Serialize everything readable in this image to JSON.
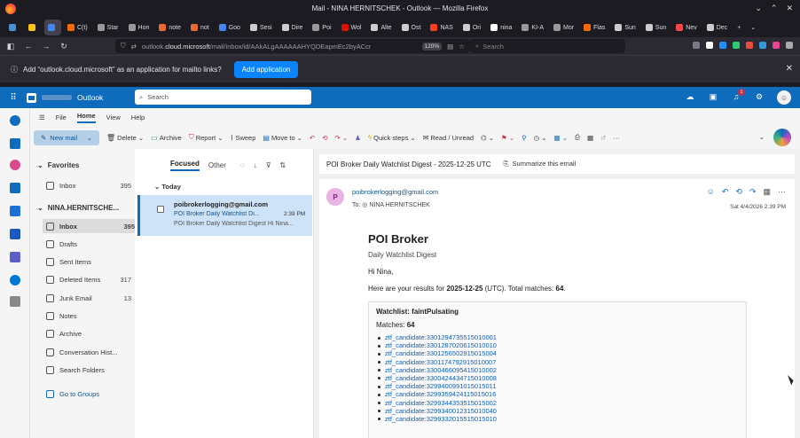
{
  "browser": {
    "window_title": "Mail - NINA HERNITSCHEK - Outlook — Mozilla Firefox",
    "tabs": [
      {
        "label": "",
        "color": "#4a90d9"
      },
      {
        "label": "",
        "color": "#f5c518"
      },
      {
        "label": "",
        "color": "#4285f4",
        "active": true
      },
      {
        "label": "C(t)",
        "color": "#ff6a00"
      },
      {
        "label": "Star",
        "color": "#999999"
      },
      {
        "label": "Hon",
        "color": "#999999"
      },
      {
        "label": "note",
        "color": "#e86a33"
      },
      {
        "label": "not",
        "color": "#e86a33"
      },
      {
        "label": "Goo",
        "color": "#4285f4"
      },
      {
        "label": "Sesi",
        "color": "#cccccc"
      },
      {
        "label": "Dire",
        "color": "#cccccc"
      },
      {
        "label": "Poi",
        "color": "#999999"
      },
      {
        "label": "Wol",
        "color": "#dd1100"
      },
      {
        "label": "Alte",
        "color": "#cccccc"
      },
      {
        "label": "Ost",
        "color": "#cccccc"
      },
      {
        "label": "NAS",
        "color": "#fc3d21"
      },
      {
        "label": "Ori",
        "color": "#cccccc"
      },
      {
        "label": "nina",
        "color": "#ffffff"
      },
      {
        "label": "KI-A",
        "color": "#999999"
      },
      {
        "label": "Mor",
        "color": "#999999"
      },
      {
        "label": "Flas",
        "color": "#ff6a00"
      },
      {
        "label": "Sun",
        "color": "#cccccc"
      },
      {
        "label": "Sun",
        "color": "#cccccc"
      },
      {
        "label": "Nev",
        "color": "#ff4444"
      },
      {
        "label": "Dec",
        "color": "#cccccc"
      }
    ],
    "url_prefix": "outlook.",
    "url_domain": "cloud.microsoft",
    "url_rest": "/mail/inbox/id/AAkALgAAAAAAHYQDEapmEc2byACcr",
    "zoom": "120%",
    "search_placeholder": "Search",
    "notification_text": "Add “outlook.cloud.microsoft” as an application for mailto links?",
    "notification_button": "Add application"
  },
  "outlook": {
    "app_name": "Outlook",
    "search_placeholder": "Search",
    "notification_count": "1",
    "menu": [
      "File",
      "Home",
      "View",
      "Help"
    ],
    "ribbon": {
      "new_mail": "New mail",
      "delete": "Delete",
      "archive": "Archive",
      "report": "Report",
      "sweep": "Sweep",
      "move_to": "Move to",
      "quick_steps": "Quick steps",
      "read_unread": "Read / Unread"
    },
    "folders": {
      "favorites_label": "Favorites",
      "favorites": [
        {
          "label": "Inbox",
          "count": "395"
        }
      ],
      "account_label": "NINA.HERNITSCHE...",
      "items": [
        {
          "label": "Inbox",
          "count": "395"
        },
        {
          "label": "Drafts",
          "count": ""
        },
        {
          "label": "Sent Items",
          "count": ""
        },
        {
          "label": "Deleted Items",
          "count": "317"
        },
        {
          "label": "Junk Email",
          "count": "13"
        },
        {
          "label": "Notes",
          "count": ""
        },
        {
          "label": "Archive",
          "count": ""
        },
        {
          "label": "Conversation Hist...",
          "count": ""
        },
        {
          "label": "Search Folders",
          "count": ""
        }
      ],
      "groups": "Go to Groups"
    },
    "list": {
      "tab_focused": "Focused",
      "tab_other": "Other",
      "group": "Today",
      "message": {
        "from": "poibrokerlogging@gmail.com",
        "subject": "POI Broker Daily Watchlist Di...",
        "time": "2:39 PM",
        "preview": "POI Broker Daily Watchlist Digest Hi Nina..."
      }
    },
    "reading": {
      "subject": "POI Broker Daily Watchlist Digest - 2025-12-25 UTC",
      "summarize": "Summarize this email",
      "sender_initial": "P",
      "sender": "poibrokerlogging@gmail.com",
      "to_label": "To:",
      "to": "NINA HERNITSCHEK",
      "date": "Sat 4/4/2026 2:39 PM",
      "body": {
        "title": "POI Broker",
        "subtitle": "Daily Watchlist Digest",
        "greeting": "Hi Nina,",
        "results_prefix": "Here are your results for ",
        "results_date": "2025-12-25",
        "results_mid": " (UTC). Total matches: ",
        "results_total": "64",
        "results_end": ".",
        "watchlist_title": "Watchlist: faintPulsating",
        "matches_label": "Matches: ",
        "matches_count": "64",
        "candidates": [
          "ztf_candidate:3301294735515010001",
          "ztf_candidate:3301287020615010010",
          "ztf_candidate:3301256502915015004",
          "ztf_candidate:3301174792915010007",
          "ztf_candidate:3300466095415010002",
          "ztf_candidate:3300424434715010008",
          "ztf_candidate:3299400991015015011",
          "ztf_candidate:3299359424115015016",
          "ztf_candidate:3299344353515015002",
          "ztf_candidate:3299340012315010040",
          "ztf_candidate:3299332015515015010"
        ]
      }
    }
  }
}
